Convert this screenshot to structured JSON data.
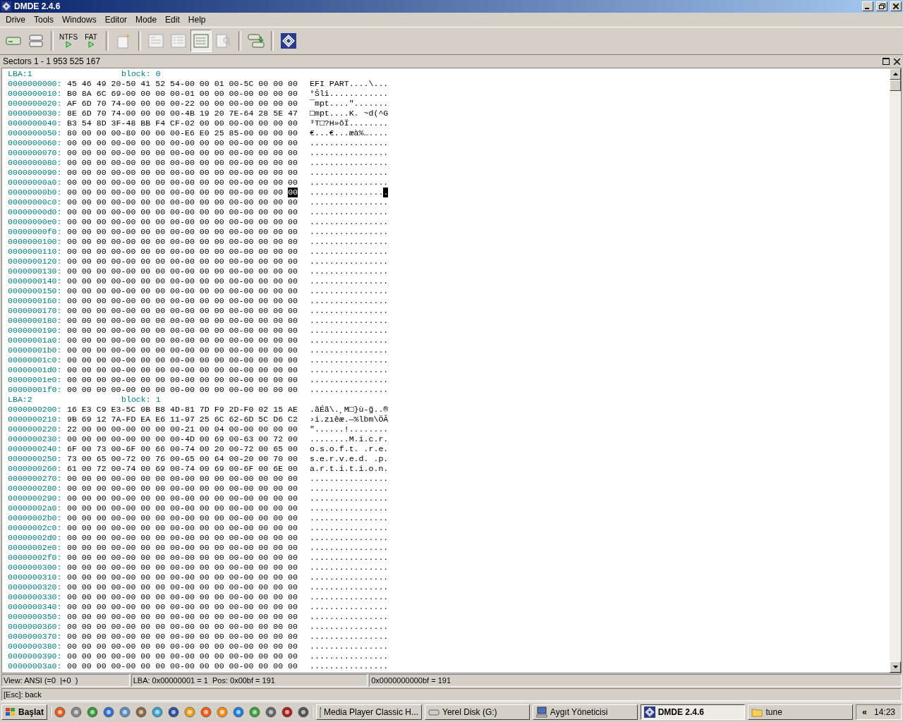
{
  "window": {
    "title": "DMDE 2.4.6"
  },
  "menu": [
    "Drive",
    "Tools",
    "Windows",
    "Editor",
    "Mode",
    "Edit",
    "Help"
  ],
  "toolbar": [
    {
      "kind": "disk",
      "selected": false
    },
    {
      "kind": "partitions",
      "selected": false
    },
    {
      "kind": "sep"
    },
    {
      "kind": "ntfs",
      "label": "NTFS",
      "selected": false
    },
    {
      "kind": "fat",
      "label": "FAT",
      "selected": false
    },
    {
      "kind": "sep"
    },
    {
      "kind": "new",
      "selected": false
    },
    {
      "kind": "sep"
    },
    {
      "kind": "table",
      "selected": false
    },
    {
      "kind": "list",
      "selected": false
    },
    {
      "kind": "hex",
      "selected": true
    },
    {
      "kind": "find",
      "selected": false
    },
    {
      "kind": "sep"
    },
    {
      "kind": "copy",
      "selected": false
    },
    {
      "kind": "sep"
    },
    {
      "kind": "logo",
      "selected": false
    }
  ],
  "panel": {
    "title": "Sectors 1 - 1 953 525 167"
  },
  "blocks": [
    {
      "lba": "LBA:1",
      "block": "block: 0",
      "rows": [
        {
          "offset": "0000000000:",
          "hex": "45 46 49 20-50 41 52 54-00 00 01 00-5C 00 00 00",
          "ascii": "EFI PART....\\..."
        },
        {
          "offset": "0000000010:",
          "hex": "B0 8A 6C 69-00 00 00 00-01 00 00 00-00 00 00 00",
          "ascii": "°Šli............"
        },
        {
          "offset": "0000000020:",
          "hex": "AF 6D 70 74-00 00 00 00-22 00 00 00-00 00 00 00",
          "ascii": "¯mpt....\"......."
        },
        {
          "offset": "0000000030:",
          "hex": "8E 6D 70 74-00 00 00 00-4B 19 20 7E-64 28 5E 47",
          "ascii": "□mpt....K. ~d(^G"
        },
        {
          "offset": "0000000040:",
          "hex": "B3 54 8D 3F-48 BB F4 CF-02 00 00 00-00 00 00 00",
          "ascii": "³T□?H»ôÏ........"
        },
        {
          "offset": "0000000050:",
          "hex": "80 00 00 00-80 00 00 00-E6 E0 25 85-00 00 00 00",
          "ascii": "€...€...æà%…...."
        },
        {
          "offset": "0000000060:",
          "hex": "00 00 00 00-00 00 00 00-00 00 00 00-00 00 00 00",
          "ascii": "................"
        },
        {
          "offset": "0000000070:",
          "hex": "00 00 00 00-00 00 00 00-00 00 00 00-00 00 00 00",
          "ascii": "................"
        },
        {
          "offset": "0000000080:",
          "hex": "00 00 00 00-00 00 00 00-00 00 00 00-00 00 00 00",
          "ascii": "................"
        },
        {
          "offset": "0000000090:",
          "hex": "00 00 00 00-00 00 00 00-00 00 00 00-00 00 00 00",
          "ascii": "................"
        },
        {
          "offset": "00000000a0:",
          "hex": "00 00 00 00-00 00 00 00-00 00 00 00-00 00 00 00",
          "ascii": "................"
        },
        {
          "offset": "00000000b0:",
          "hex": "00 00 00 00-00 00 00 00-00 00 00 00-00 00 00",
          "hex_selected": "00",
          "ascii": "...............",
          "ascii_selected": "."
        },
        {
          "offset": "00000000c0:",
          "hex": "00 00 00 00-00 00 00 00-00 00 00 00-00 00 00 00",
          "ascii": "................"
        },
        {
          "offset": "00000000d0:",
          "hex": "00 00 00 00-00 00 00 00-00 00 00 00-00 00 00 00",
          "ascii": "................"
        },
        {
          "offset": "00000000e0:",
          "hex": "00 00 00 00-00 00 00 00-00 00 00 00-00 00 00 00",
          "ascii": "................"
        },
        {
          "offset": "00000000f0:",
          "hex": "00 00 00 00-00 00 00 00-00 00 00 00-00 00 00 00",
          "ascii": "................"
        },
        {
          "offset": "0000000100:",
          "hex": "00 00 00 00-00 00 00 00-00 00 00 00-00 00 00 00",
          "ascii": "................"
        },
        {
          "offset": "0000000110:",
          "hex": "00 00 00 00-00 00 00 00-00 00 00 00-00 00 00 00",
          "ascii": "................"
        },
        {
          "offset": "0000000120:",
          "hex": "00 00 00 00-00 00 00 00-00 00 00 00-00 00 00 00",
          "ascii": "................"
        },
        {
          "offset": "0000000130:",
          "hex": "00 00 00 00-00 00 00 00-00 00 00 00-00 00 00 00",
          "ascii": "................"
        },
        {
          "offset": "0000000140:",
          "hex": "00 00 00 00-00 00 00 00-00 00 00 00-00 00 00 00",
          "ascii": "................"
        },
        {
          "offset": "0000000150:",
          "hex": "00 00 00 00-00 00 00 00-00 00 00 00-00 00 00 00",
          "ascii": "................"
        },
        {
          "offset": "0000000160:",
          "hex": "00 00 00 00-00 00 00 00-00 00 00 00-00 00 00 00",
          "ascii": "................"
        },
        {
          "offset": "0000000170:",
          "hex": "00 00 00 00-00 00 00 00-00 00 00 00-00 00 00 00",
          "ascii": "................"
        },
        {
          "offset": "0000000180:",
          "hex": "00 00 00 00-00 00 00 00-00 00 00 00-00 00 00 00",
          "ascii": "................"
        },
        {
          "offset": "0000000190:",
          "hex": "00 00 00 00-00 00 00 00-00 00 00 00-00 00 00 00",
          "ascii": "................"
        },
        {
          "offset": "00000001a0:",
          "hex": "00 00 00 00-00 00 00 00-00 00 00 00-00 00 00 00",
          "ascii": "................"
        },
        {
          "offset": "00000001b0:",
          "hex": "00 00 00 00-00 00 00 00-00 00 00 00-00 00 00 00",
          "ascii": "................"
        },
        {
          "offset": "00000001c0:",
          "hex": "00 00 00 00-00 00 00 00-00 00 00 00-00 00 00 00",
          "ascii": "................"
        },
        {
          "offset": "00000001d0:",
          "hex": "00 00 00 00-00 00 00 00-00 00 00 00-00 00 00 00",
          "ascii": "................"
        },
        {
          "offset": "00000001e0:",
          "hex": "00 00 00 00-00 00 00 00-00 00 00 00-00 00 00 00",
          "ascii": "................"
        },
        {
          "offset": "00000001f0:",
          "hex": "00 00 00 00-00 00 00 00-00 00 00 00-00 00 00 00",
          "ascii": "................"
        }
      ]
    },
    {
      "lba": "LBA:2",
      "block": "block: 1",
      "rows": [
        {
          "offset": "0000000200:",
          "hex": "16 E3 C9 E3-5C 0B B8 4D-81 7D F9 2D-F0 02 15 AE",
          "ascii": ".ãÉã\\.¸M□}ù-ğ..®"
        },
        {
          "offset": "0000000210:",
          "hex": "9B 69 12 7A-FD EA E6 11-97 25 6C 62-6D 5C D6 C2",
          "ascii": "›i.zıêæ.—%lbm\\ÖÂ"
        },
        {
          "offset": "0000000220:",
          "hex": "22 00 00 00-00 00 00 00-21 00 04 00-00 00 00 00",
          "ascii": "\"......!........"
        },
        {
          "offset": "0000000230:",
          "hex": "00 00 00 00-00 00 00 00-4D 00 69 00-63 00 72 00",
          "ascii": "........M.i.c.r."
        },
        {
          "offset": "0000000240:",
          "hex": "6F 00 73 00-6F 00 66 00-74 00 20 00-72 00 65 00",
          "ascii": "o.s.o.f.t. .r.e."
        },
        {
          "offset": "0000000250:",
          "hex": "73 00 65 00-72 00 76 00-65 00 64 00-20 00 70 00",
          "ascii": "s.e.r.v.e.d. .p."
        },
        {
          "offset": "0000000260:",
          "hex": "61 00 72 00-74 00 69 00-74 00 69 00-6F 00 6E 00",
          "ascii": "a.r.t.i.t.i.o.n."
        },
        {
          "offset": "0000000270:",
          "hex": "00 00 00 00-00 00 00 00-00 00 00 00-00 00 00 00",
          "ascii": "................"
        },
        {
          "offset": "0000000280:",
          "hex": "00 00 00 00-00 00 00 00-00 00 00 00-00 00 00 00",
          "ascii": "................"
        },
        {
          "offset": "0000000290:",
          "hex": "00 00 00 00-00 00 00 00-00 00 00 00-00 00 00 00",
          "ascii": "................"
        },
        {
          "offset": "00000002a0:",
          "hex": "00 00 00 00-00 00 00 00-00 00 00 00-00 00 00 00",
          "ascii": "................"
        },
        {
          "offset": "00000002b0:",
          "hex": "00 00 00 00-00 00 00 00-00 00 00 00-00 00 00 00",
          "ascii": "................"
        },
        {
          "offset": "00000002c0:",
          "hex": "00 00 00 00-00 00 00 00-00 00 00 00-00 00 00 00",
          "ascii": "................"
        },
        {
          "offset": "00000002d0:",
          "hex": "00 00 00 00-00 00 00 00-00 00 00 00-00 00 00 00",
          "ascii": "................"
        },
        {
          "offset": "00000002e0:",
          "hex": "00 00 00 00-00 00 00 00-00 00 00 00-00 00 00 00",
          "ascii": "................"
        },
        {
          "offset": "00000002f0:",
          "hex": "00 00 00 00-00 00 00 00-00 00 00 00-00 00 00 00",
          "ascii": "................"
        },
        {
          "offset": "0000000300:",
          "hex": "00 00 00 00-00 00 00 00-00 00 00 00-00 00 00 00",
          "ascii": "................"
        },
        {
          "offset": "0000000310:",
          "hex": "00 00 00 00-00 00 00 00-00 00 00 00-00 00 00 00",
          "ascii": "................"
        },
        {
          "offset": "0000000320:",
          "hex": "00 00 00 00-00 00 00 00-00 00 00 00-00 00 00 00",
          "ascii": "................"
        },
        {
          "offset": "0000000330:",
          "hex": "00 00 00 00-00 00 00 00-00 00 00 00-00 00 00 00",
          "ascii": "................"
        },
        {
          "offset": "0000000340:",
          "hex": "00 00 00 00-00 00 00 00-00 00 00 00-00 00 00 00",
          "ascii": "................"
        },
        {
          "offset": "0000000350:",
          "hex": "00 00 00 00-00 00 00 00-00 00 00 00-00 00 00 00",
          "ascii": "................"
        },
        {
          "offset": "0000000360:",
          "hex": "00 00 00 00-00 00 00 00-00 00 00 00-00 00 00 00",
          "ascii": "................"
        },
        {
          "offset": "0000000370:",
          "hex": "00 00 00 00-00 00 00 00-00 00 00 00-00 00 00 00",
          "ascii": "................"
        },
        {
          "offset": "0000000380:",
          "hex": "00 00 00 00-00 00 00 00-00 00 00 00-00 00 00 00",
          "ascii": "................"
        },
        {
          "offset": "0000000390:",
          "hex": "00 00 00 00-00 00 00 00-00 00 00 00-00 00 00 00",
          "ascii": "................"
        },
        {
          "offset": "00000003a0:",
          "hex": "00 00 00 00-00 00 00 00-00 00 00 00-00 00 00 00",
          "ascii": "................"
        }
      ]
    }
  ],
  "status_bar": [
    "View: ANSI (=0  |+0  )",
    "LBA: 0x00000001 = 1  Pos: 0x00bf = 191",
    "0x0000000000bf = 191"
  ],
  "hint": "[Esc]: back",
  "taskbar": {
    "start": "Başlat",
    "tasks": [
      {
        "label": "Media Player Classic H...",
        "kind": "player",
        "selected": false
      },
      {
        "label": "Yerel Disk (G:)",
        "kind": "drive",
        "selected": false
      },
      {
        "label": "Aygıt Yöneticisi",
        "kind": "computer",
        "selected": false
      },
      {
        "label": "DMDE 2.4.6",
        "kind": "logo",
        "selected": true
      },
      {
        "label": "tune",
        "kind": "folder",
        "selected": false
      }
    ],
    "tray": "«",
    "clock": "14:23"
  }
}
